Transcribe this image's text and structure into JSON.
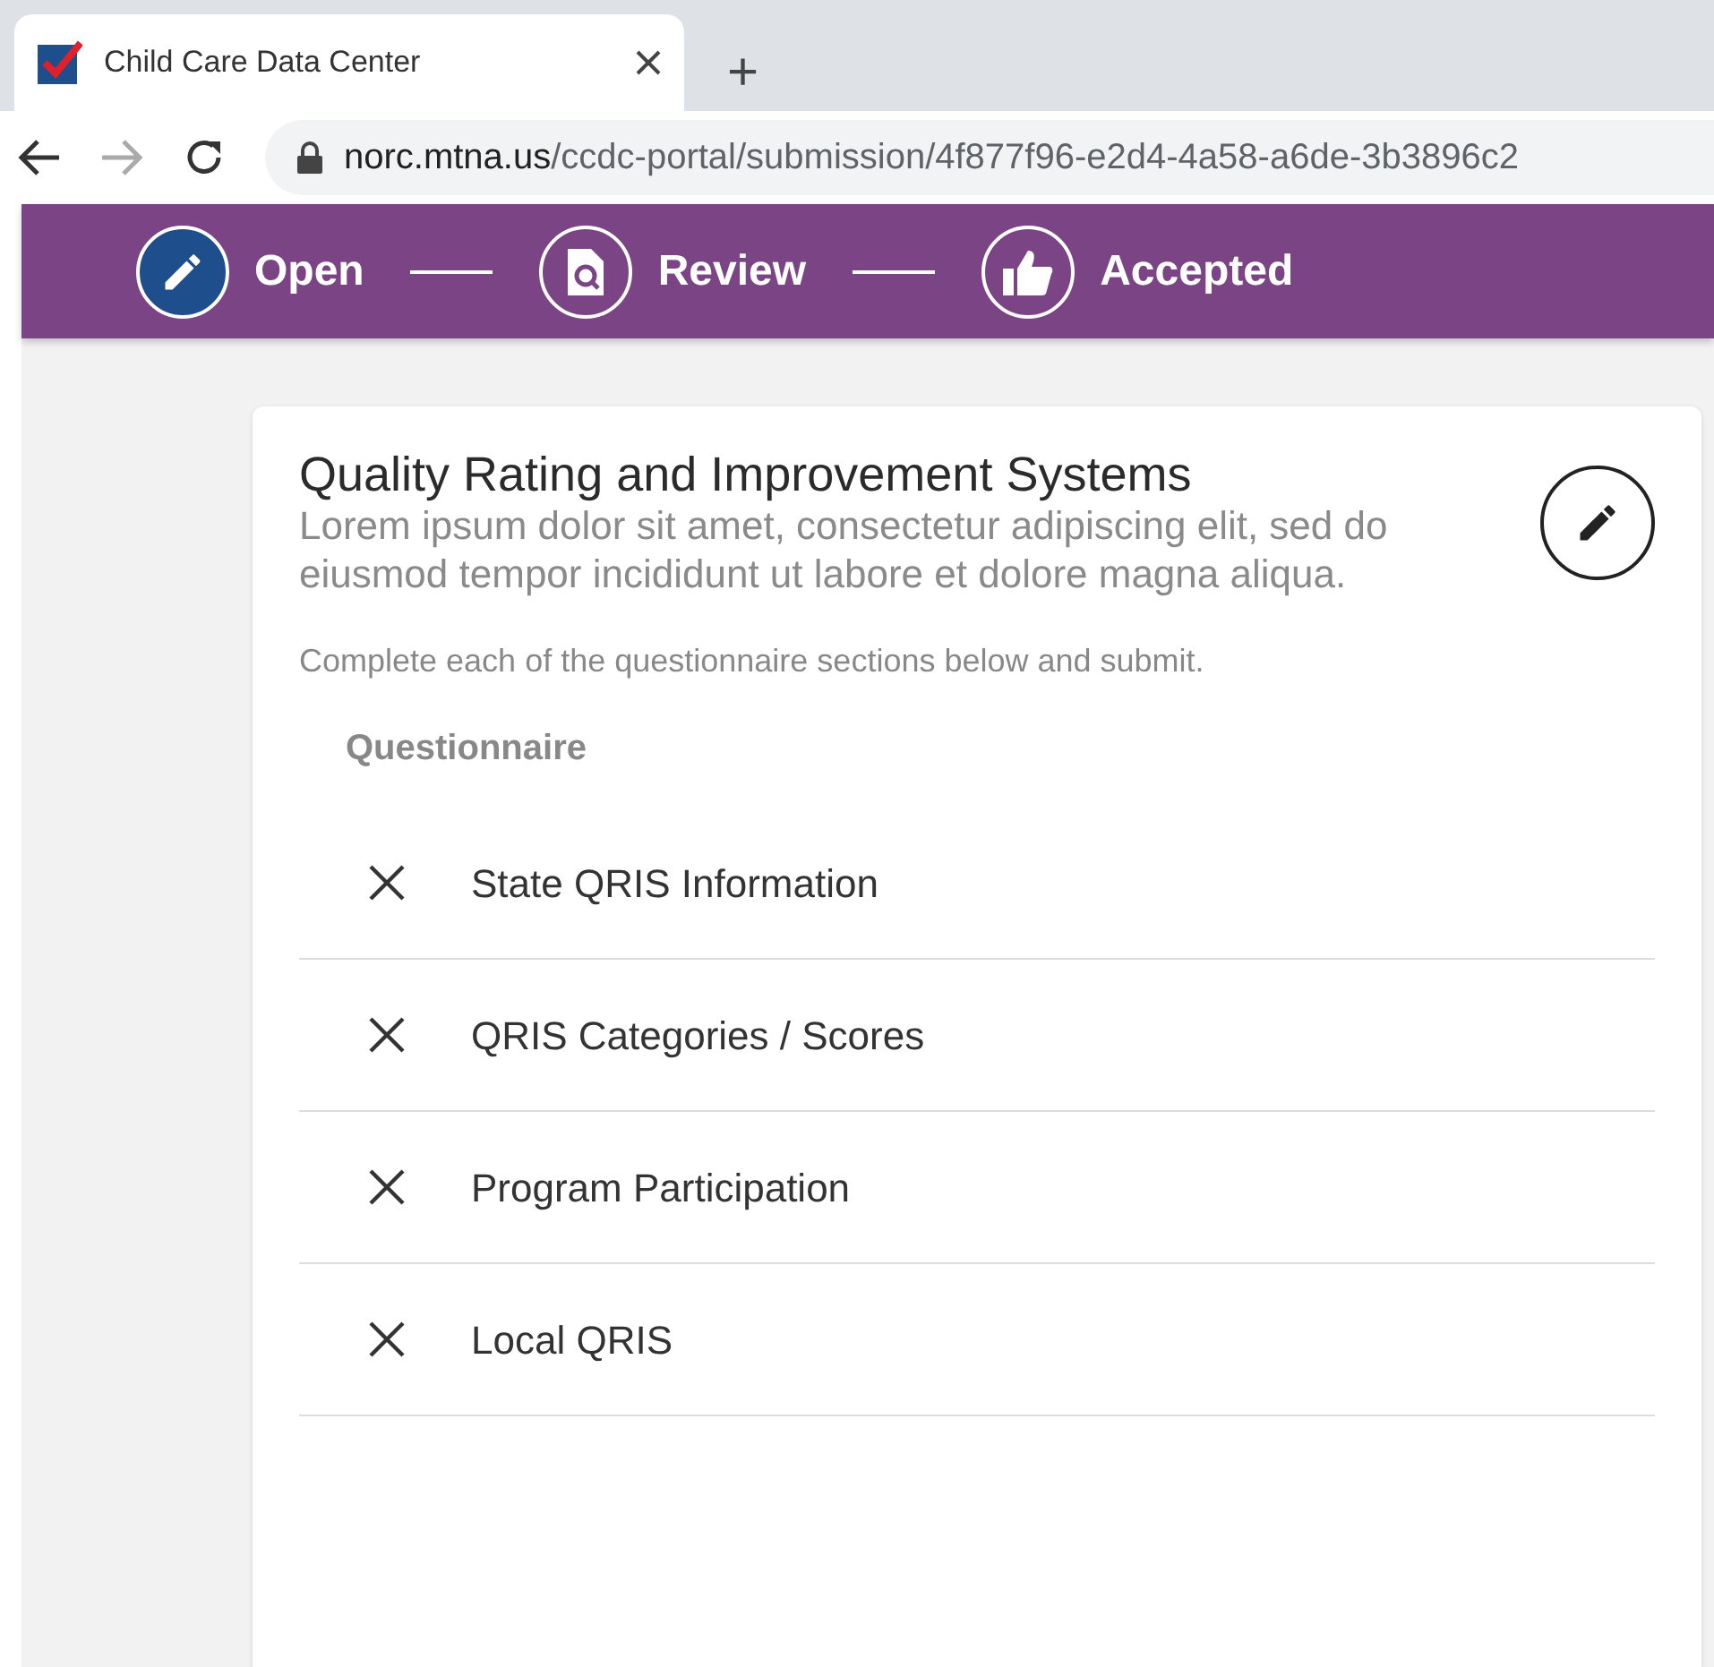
{
  "browser": {
    "tab_title": "Child Care Data Center",
    "new_tab": "+",
    "url_host": "norc.mtna.us",
    "url_path": "/ccdc-portal/submission/4f877f96-e2d4-4a58-a6de-3b3896c2"
  },
  "steps": [
    {
      "label": "Open",
      "kind": "edit",
      "selected": true
    },
    {
      "label": "Review",
      "kind": "review",
      "selected": false
    },
    {
      "label": "Accepted",
      "kind": "accepted",
      "selected": false
    }
  ],
  "card": {
    "title": "Quality Rating and Improvement Systems",
    "description": "Lorem ipsum dolor sit amet, consectetur adipiscing elit, sed do eiusmod tempor incididunt ut labore et dolore magna aliqua.",
    "instruction": "Complete each of the questionnaire sections below and submit.",
    "section_heading": "Questionnaire",
    "sections": [
      {
        "label": "State QRIS Information",
        "complete": false
      },
      {
        "label": "QRIS Categories / Scores",
        "complete": false
      },
      {
        "label": "Program Participation",
        "complete": false
      },
      {
        "label": "Local QRIS",
        "complete": false
      }
    ]
  }
}
